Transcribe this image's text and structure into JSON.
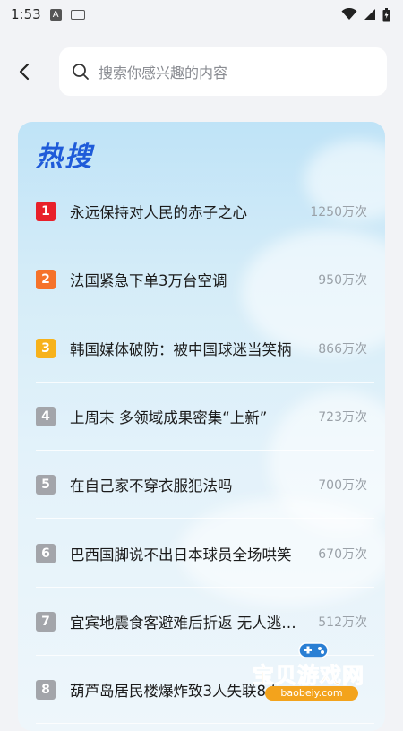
{
  "status_bar": {
    "time": "1:53",
    "icons": [
      "a-icon",
      "keyboard-icon",
      "wifi-icon",
      "signal-icon",
      "battery-icon"
    ]
  },
  "search": {
    "placeholder": "搜索你感兴趣的内容",
    "icons": [
      "back-icon",
      "search-icon"
    ]
  },
  "hot": {
    "title": "热搜",
    "items": [
      {
        "rank": "1",
        "title": "永远保持对人民的赤子之心",
        "count": "1250万次",
        "rank_color": "#e8202a"
      },
      {
        "rank": "2",
        "title": "法国紧急下单3万台空调",
        "count": "950万次",
        "rank_color": "#f5722a"
      },
      {
        "rank": "3",
        "title": "韩国媒体破防：被中国球迷当笑柄",
        "count": "866万次",
        "rank_color": "#f7b21b"
      },
      {
        "rank": "4",
        "title": "上周末 多领域成果密集“上新”",
        "count": "723万次",
        "rank_color": "#a3a5aa"
      },
      {
        "rank": "5",
        "title": "在自己家不穿衣服犯法吗",
        "count": "700万次",
        "rank_color": "#a3a5aa"
      },
      {
        "rank": "6",
        "title": "巴西国脚说不出日本球员全场哄笑",
        "count": "670万次",
        "rank_color": "#a3a5aa"
      },
      {
        "rank": "7",
        "title": "宜宾地震食客避难后折返 无人逃…",
        "count": "512万次",
        "rank_color": "#a3a5aa"
      },
      {
        "rank": "8",
        "title": "葫芦岛居民楼爆炸致3人失联8人…",
        "count": "",
        "rank_color": "#a3a5aa"
      }
    ]
  },
  "watermark": {
    "text": "宝贝游戏网",
    "url": "baobeiy.com"
  }
}
